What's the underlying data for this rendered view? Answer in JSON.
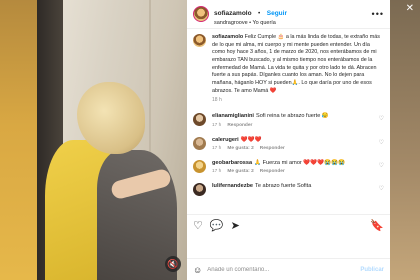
{
  "header": {
    "username": "sofiazamolo",
    "separator": "•",
    "follow": "Seguir",
    "subtitle": "sandragroove • Yo quería",
    "more_icon": "more-horizontal-icon"
  },
  "caption": {
    "username": "sofiazamolo",
    "text": "Feliz Cumple 🎂 a la más linda de todas, te extraño más de lo que mi alma, mi cuerpo y mi mente pueden entender. Un día como hoy hace 3 años, 1 de marzo de 2020, nos enterábamos de mi embarazo TAN buscado, y al mismo tiempo nos enterábamos de la enfermedad de Mamá. La vida te quita y por otro lado te dá. Abracen fuerte a sus papás. Díganles cuanto los aman. No lo dejen para mañana, háganlo HOY si pueden🙏. Lo que daría por uno de esos abrazos. Te amo Mamá ❤️",
    "time": "18 h"
  },
  "comments": [
    {
      "username": "elianamiglianini",
      "text": "Sofi reina te abrazo fuerte 😥",
      "time": "17 h",
      "likes": "",
      "reply": "Responder"
    },
    {
      "username": "calerugeri",
      "text": "❤️❤️❤️",
      "time": "17 h",
      "likes": "Me gusta: 2",
      "reply": "Responder"
    },
    {
      "username": "geobarbarossa",
      "text": "🙏 Fuerza mi amor ❤️❤️❤️😭😭😭",
      "time": "17 h",
      "likes": "Me gusta: 2",
      "reply": "Responder"
    },
    {
      "username": "lulifernandezbe",
      "text": "Te abrazo fuerte Sofita",
      "time": "",
      "likes": "",
      "reply": ""
    }
  ],
  "actions": {
    "like_icon": "heart-icon",
    "comment_icon": "comment-icon",
    "share_icon": "share-icon",
    "save_icon": "bookmark-icon"
  },
  "likes_text": "",
  "compose": {
    "placeholder": "Añade un comentario...",
    "post": "Publicar",
    "emoji_icon": "emoji-icon"
  },
  "colors": {
    "accent": "#0095f6",
    "like_red": "#ed4956"
  }
}
